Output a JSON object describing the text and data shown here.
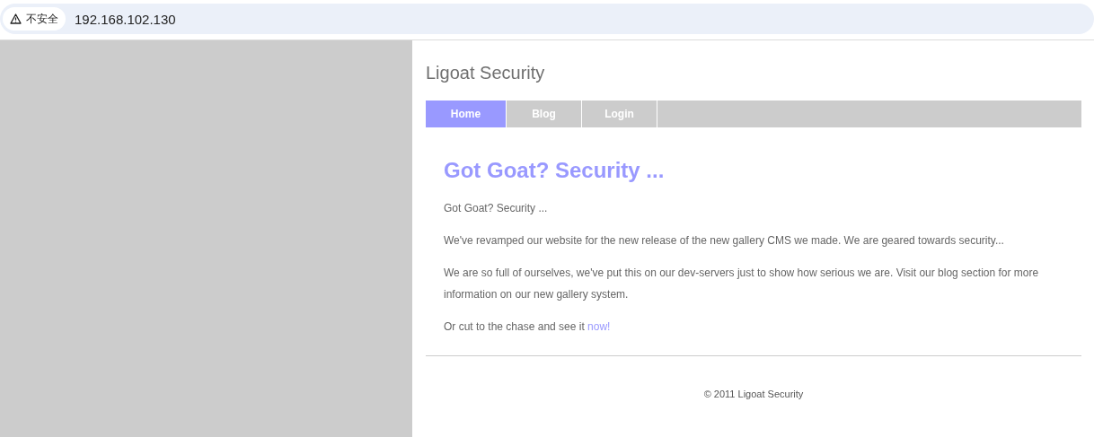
{
  "address_bar": {
    "security_label": "不安全",
    "url": "192.168.102.130"
  },
  "site": {
    "title": "Ligoat Security",
    "nav": [
      {
        "label": "Home",
        "selected": true
      },
      {
        "label": "Blog",
        "selected": false
      },
      {
        "label": "Login",
        "selected": false
      }
    ],
    "heading": "Got Goat? Security ...",
    "paragraphs": [
      "Got Goat? Security ...",
      "We've revamped our website for the new release of the new gallery CMS we made. We are geared towards security...",
      "We are so full of ourselves, we've put this on our dev-servers just to show how serious we are. Visit our blog section for more information on our new gallery system."
    ],
    "last_paragraph": {
      "text": "Or cut to the chase and see it ",
      "link": "now!"
    },
    "footer": "© 2011 Ligoat Security"
  }
}
